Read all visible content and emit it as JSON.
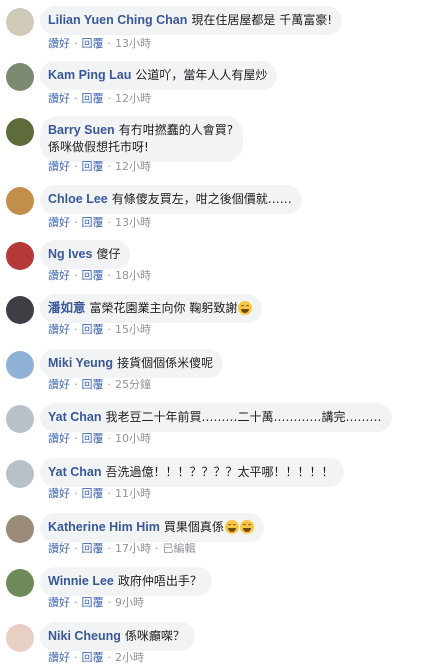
{
  "comments": [
    {
      "name": "Lilian Yuen Ching Chan",
      "text": "現在住居屋都是 千萬富豪!",
      "like": "讚好",
      "reply": "回覆",
      "time": "13小時",
      "avatar_color": "#cfc9b8",
      "avatar_icon": "cat-avatar"
    },
    {
      "name": "Kam Ping Lau",
      "text": "公道吖，當年人人有屋炒",
      "like": "讚好",
      "reply": "回覆",
      "time": "12小時",
      "avatar_color": "#7c8a72",
      "avatar_icon": "landscape-avatar"
    },
    {
      "name": "Barry Suen",
      "text": "有冇咁撚蠢的人會買?",
      "text2": "係咪做假想托市呀!",
      "like": "讚好",
      "reply": "回覆",
      "time": "12小時",
      "avatar_color": "#5e6b3b",
      "avatar_icon": "plant-avatar"
    },
    {
      "name": "Chloe Lee",
      "text": "有條傻友買左，咁之後個價就……",
      "like": "讚好",
      "reply": "回覆",
      "time": "13小時",
      "avatar_color": "#c28f4b",
      "avatar_icon": "dog-avatar"
    },
    {
      "name": "Ng Ives",
      "text": "傻仔",
      "like": "讚好",
      "reply": "回覆",
      "time": "18小時",
      "avatar_color": "#b43a3a",
      "avatar_icon": "car-avatar"
    },
    {
      "name": "潘如意",
      "text": "富榮花園業主向你 鞠躬致謝",
      "emoji_count": 1,
      "like": "讚好",
      "reply": "回覆",
      "time": "15小時",
      "avatar_color": "#3d3f45",
      "avatar_icon": "person-avatar"
    },
    {
      "name": "Miki Yeung",
      "text": "接貨個個係米傻呢",
      "like": "讚好",
      "reply": "回覆",
      "time": "25分鐘",
      "avatar_color": "#8fb1d6",
      "avatar_icon": "flower-avatar"
    },
    {
      "name": "Yat Chan",
      "text": "我老豆二十年前買………二十萬…………講完………",
      "like": "讚好",
      "reply": "回覆",
      "time": "10小時",
      "avatar_color": "#b8c0c8",
      "avatar_icon": "building-avatar"
    },
    {
      "name": "Yat Chan",
      "text": "吾洗過億！！！？？？？太平哪！！！！！",
      "like": "讚好",
      "reply": "回覆",
      "time": "11小時",
      "avatar_color": "#b8c0c8",
      "avatar_icon": "building-avatar"
    },
    {
      "name": "Katherine Him Him",
      "text": "買果個真係",
      "emoji_count": 2,
      "like": "讚好",
      "reply": "回覆",
      "time": "17小時",
      "edited": "已編輯",
      "avatar_color": "#9a8c78",
      "avatar_icon": "person-avatar"
    },
    {
      "name": "Winnie Lee",
      "text": "政府仲唔出手？",
      "like": "讚好",
      "reply": "回覆",
      "time": "9小時",
      "avatar_color": "#6f8a5a",
      "avatar_icon": "grass-avatar"
    },
    {
      "name": "Niki Cheung",
      "text": "係咪癲㗎？",
      "like": "讚好",
      "reply": "回覆",
      "time": "2小時",
      "avatar_color": "#e7cfc4",
      "avatar_icon": "person-avatar"
    }
  ],
  "colors": {
    "name": "#385898",
    "action": "#4267b2",
    "bubble": "#f2f3f5",
    "meta": "#90949c"
  }
}
